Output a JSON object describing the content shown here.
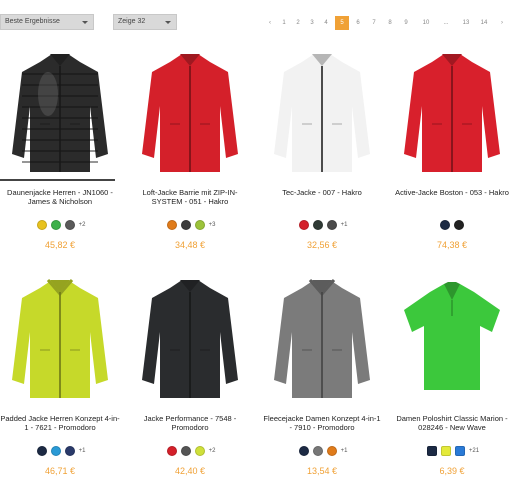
{
  "toolbar": {
    "sort_select": "Beste Ergebnisse",
    "show_select": "Zeige 32",
    "pagination": [
      "‹",
      "1",
      "2",
      "3",
      "4",
      "5",
      "6",
      "7",
      "8",
      "9",
      "10",
      "...",
      "13",
      "14",
      "›"
    ],
    "active_page": "5"
  },
  "products": [
    {
      "title": "Daunenjacke Herren - JN1060 - James & Nicholson",
      "price": "45,82 €",
      "swatches": [
        "#e8c21e",
        "#3db04a",
        "#5a5a5a"
      ],
      "more": "+2",
      "shirt_swatches": false,
      "garment": "puffer",
      "color": "#2b2b2b"
    },
    {
      "title": "Loft-Jacke Barrie mit ZIP-IN-SYSTEM - 051 - Hakro",
      "price": "34,48 €",
      "swatches": [
        "#e07b1a",
        "#3c3c3c",
        "#9cc33a"
      ],
      "more": "+3",
      "shirt_swatches": false,
      "garment": "jacket",
      "color": "#d4202a"
    },
    {
      "title": "Tec-Jacke - 007 - Hakro",
      "price": "32,56 €",
      "swatches": [
        "#d4202a",
        "#2f3a35",
        "#4a4a4a"
      ],
      "more": "+1",
      "shirt_swatches": false,
      "garment": "softshell",
      "color": "#f2f2f2"
    },
    {
      "title": "Active-Jacke Boston - 053 - Hakro",
      "price": "74,38 €",
      "swatches": [
        "#1c2a44",
        "#222222"
      ],
      "more": "",
      "shirt_swatches": false,
      "garment": "jacket",
      "color": "#d8202c"
    },
    {
      "title": "Padded Jacke Herren Konzept 4-in-1 - 7621 - Promodoro",
      "price": "46,71 €",
      "swatches": [
        "#1c2a44",
        "#2a9ad6",
        "#2a3a6a"
      ],
      "more": "+1",
      "shirt_swatches": false,
      "garment": "padded",
      "color": "#c6d92a"
    },
    {
      "title": "Jacke Performance - 7548 - Promodoro",
      "price": "42,40 €",
      "swatches": [
        "#d4202a",
        "#555555",
        "#cfe03a"
      ],
      "more": "+2",
      "shirt_swatches": false,
      "garment": "jacket",
      "color": "#2a2c2e"
    },
    {
      "title": "Fleecejacke Damen Konzept 4-in-1 - 7910 - Promodoro",
      "price": "13,54 €",
      "swatches": [
        "#1c2a44",
        "#777777",
        "#e07b1a"
      ],
      "more": "+1",
      "shirt_swatches": false,
      "garment": "fleece",
      "color": "#7b7b7b"
    },
    {
      "title": "Damen Poloshirt Classic Marion - 028246 - New Wave",
      "price": "6,39 €",
      "swatches": [
        "#1c2a44",
        "#e4ea3a",
        "#2a7ad6"
      ],
      "more": "+21",
      "shirt_swatches": true,
      "garment": "polo",
      "color": "#3cc83c"
    }
  ]
}
